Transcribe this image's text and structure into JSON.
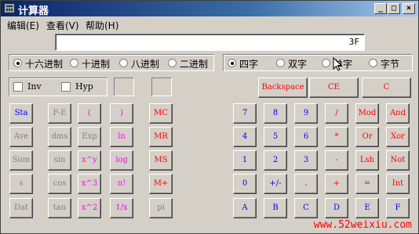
{
  "title": "计算器",
  "menu": [
    "编辑(E)",
    "查看(V)",
    "帮助(H)"
  ],
  "window_buttons": {
    "minimize": "_",
    "maximize": "□",
    "close": "×"
  },
  "display": "3F",
  "base_radios": [
    {
      "label": "十六进制",
      "checked": true
    },
    {
      "label": "十进制",
      "checked": false
    },
    {
      "label": "八进制",
      "checked": false
    },
    {
      "label": "二进制",
      "checked": false
    }
  ],
  "word_radios": [
    {
      "label": "四字",
      "checked": true
    },
    {
      "label": "双字",
      "checked": false
    },
    {
      "label": "单字",
      "checked": false
    },
    {
      "label": "字节",
      "checked": false
    }
  ],
  "checks": [
    {
      "label": "Inv"
    },
    {
      "label": "Hyp"
    }
  ],
  "top_buttons": [
    "Backspace",
    "CE",
    "C"
  ],
  "sci_buttons": [
    [
      "Sta",
      "F-E",
      "(",
      ")"
    ],
    [
      "Ave",
      "dms",
      "Exp",
      "ln"
    ],
    [
      "Sum",
      "sin",
      "x^y",
      "log"
    ],
    [
      "s",
      "cos",
      "x^3",
      "n!"
    ],
    [
      "Dat",
      "tan",
      "x^2",
      "1/x"
    ]
  ],
  "mem_buttons": [
    "MC",
    "MR",
    "MS",
    "M+",
    "pi"
  ],
  "num_buttons": [
    [
      "7",
      "8",
      "9",
      "/",
      "Mod",
      "And"
    ],
    [
      "4",
      "5",
      "6",
      "*",
      "Or",
      "Xor"
    ],
    [
      "1",
      "2",
      "3",
      "-",
      "Lsh",
      "Not"
    ],
    [
      "0",
      "+/-",
      ".",
      "+",
      "=",
      "Int"
    ],
    [
      "A",
      "B",
      "C",
      "D",
      "E",
      "F"
    ]
  ],
  "watermark": "www.52weixiu.com"
}
